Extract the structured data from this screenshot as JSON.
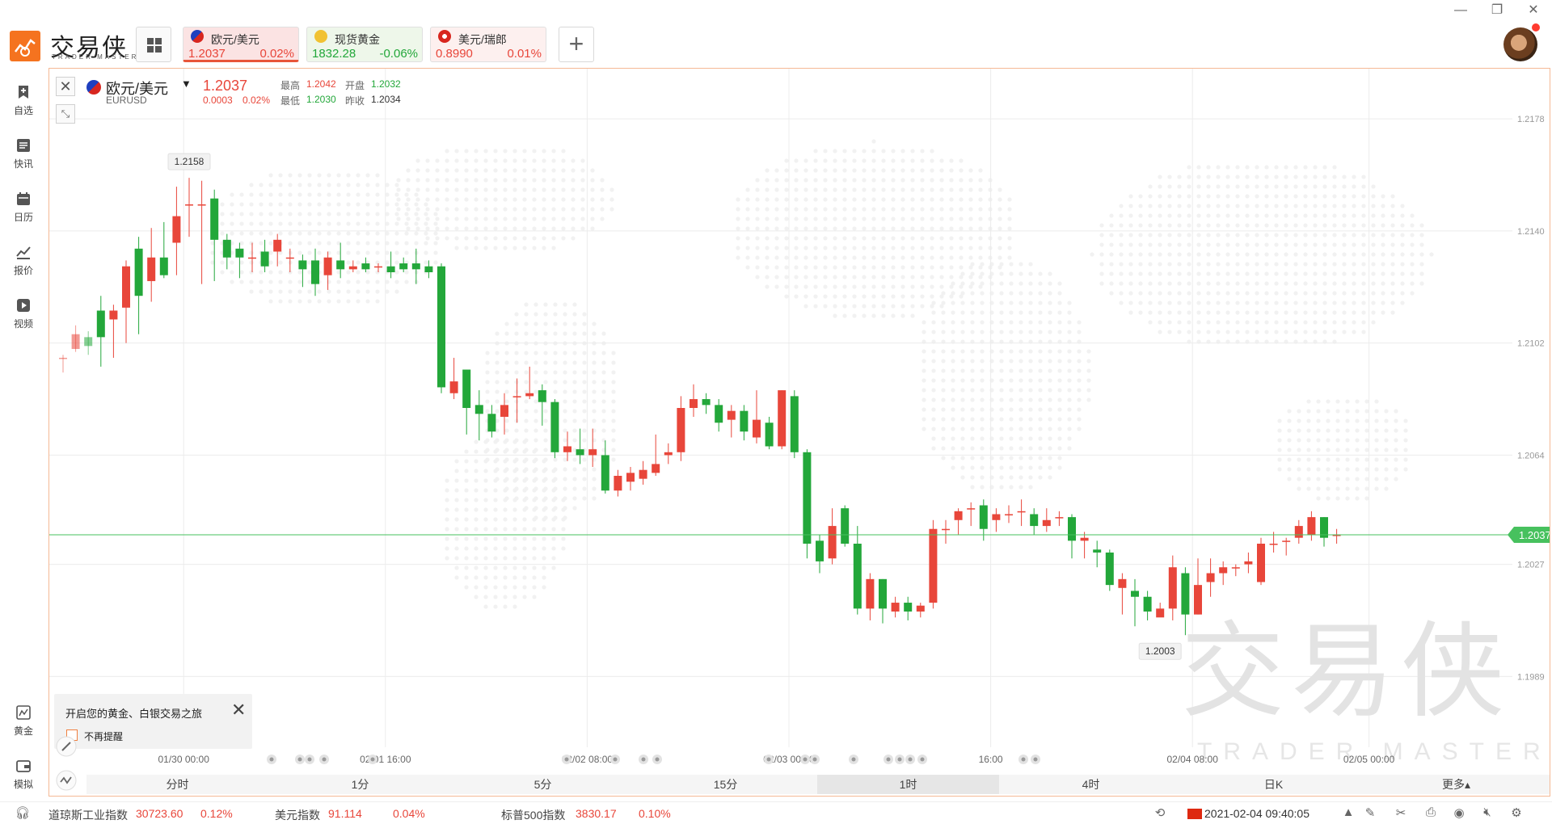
{
  "app": {
    "logo_text": "交易侠",
    "logo_sub": "TRADER MASTER"
  },
  "window_controls": {
    "minimize": "—",
    "restore": "❐",
    "close": "✕"
  },
  "quote_cards": [
    {
      "name": "欧元/美元",
      "price": "1.2037",
      "change": "0.02%",
      "direction": "up",
      "active": true,
      "flag": "us-eu"
    },
    {
      "name": "现货黄金",
      "price": "1832.28",
      "change": "-0.06%",
      "direction": "down",
      "active": false,
      "flag": "gold"
    },
    {
      "name": "美元/瑞郎",
      "price": "0.8990",
      "change": "0.01%",
      "direction": "up",
      "active": false,
      "flag": "ch"
    }
  ],
  "add_button": "+",
  "sidebar": {
    "items": [
      {
        "label": "自选",
        "icon": "bookmark-add-icon"
      },
      {
        "label": "快讯",
        "icon": "news-icon"
      },
      {
        "label": "日历",
        "icon": "calendar-icon"
      },
      {
        "label": "报价",
        "icon": "quote-chart-icon"
      },
      {
        "label": "视频",
        "icon": "video-icon"
      }
    ],
    "bottom_items": [
      {
        "label": "黄金",
        "icon": "gold-icon"
      },
      {
        "label": "模拟",
        "icon": "wallet-icon"
      }
    ]
  },
  "symbol": {
    "name": "欧元/美元",
    "code": "EURUSD",
    "price": "1.2037",
    "change": "0.0003",
    "change_pct": "0.02%",
    "stats": {
      "high_label": "最高",
      "high": "1.2042",
      "open_label": "开盘",
      "open": "1.2032",
      "low_label": "最低",
      "low": "1.2030",
      "prev_close_label": "昨收",
      "prev_close": "1.2034"
    }
  },
  "notice": {
    "text": "开启您的黄金、白银交易之旅",
    "checkbox_label": "不再提醒"
  },
  "watermark": {
    "title": "交易侠",
    "sub": "TRADER MASTER"
  },
  "timeframes": [
    {
      "label": "分时",
      "active": false
    },
    {
      "label": "1分",
      "active": false
    },
    {
      "label": "5分",
      "active": false
    },
    {
      "label": "15分",
      "active": false
    },
    {
      "label": "1时",
      "active": true
    },
    {
      "label": "4时",
      "active": false
    },
    {
      "label": "日K",
      "active": false
    },
    {
      "label": "更多▴",
      "active": false
    }
  ],
  "status_bar": {
    "indices": [
      {
        "name": "道琼斯工业指数",
        "value": "30723.60",
        "change": "0.12%"
      },
      {
        "name": "美元指数",
        "value": "91.114",
        "change": "0.04%"
      },
      {
        "name": "标普500指数",
        "value": "3830.17",
        "change": "0.10%"
      }
    ],
    "datetime": "2021-02-04 09:40:05"
  },
  "colors": {
    "up": "#e8463a",
    "down": "#23a73a",
    "accent": "#f5731f",
    "current_price_line": "#47c15e"
  },
  "chart_data": {
    "type": "candlestick",
    "symbol": "EURUSD",
    "timeframe": "1时",
    "ylim": [
      1.1965,
      1.2195
    ],
    "y_ticks": [
      "1.2178",
      "1.2140",
      "1.2102",
      "1.2064",
      "1.2027",
      "1.1989"
    ],
    "x_ticks": [
      "01/30 00:00",
      "02/01 16:00",
      "02/02 08:00",
      "02/03 00:00",
      "16:00",
      "02/04 08:00",
      "02/05 00:00"
    ],
    "current_price": "1.2037",
    "max_marker": "1.2158",
    "min_marker": "1.2003",
    "candles": [
      [
        1.2097,
        1.2097,
        1.2092,
        1.2098
      ],
      [
        1.21,
        1.2105,
        1.2099,
        1.2108
      ],
      [
        1.2104,
        1.2101,
        1.2098,
        1.2106
      ],
      [
        1.2113,
        1.2104,
        1.2094,
        1.2118
      ],
      [
        1.211,
        1.2113,
        1.2097,
        1.2115
      ],
      [
        1.2114,
        1.2128,
        1.2102,
        1.213
      ],
      [
        1.2134,
        1.2118,
        1.2105,
        1.2138
      ],
      [
        1.2123,
        1.2131,
        1.2116,
        1.2141
      ],
      [
        1.2131,
        1.2125,
        1.2124,
        1.2143
      ],
      [
        1.2136,
        1.2145,
        1.2125,
        1.2155
      ],
      [
        1.2149,
        1.2149,
        1.2138,
        1.2158
      ],
      [
        1.2149,
        1.2149,
        1.2122,
        1.2157
      ],
      [
        1.2151,
        1.2137,
        1.2123,
        1.2154
      ],
      [
        1.2137,
        1.2131,
        1.2127,
        1.2139
      ],
      [
        1.2134,
        1.2131,
        1.2124,
        1.2136
      ],
      [
        1.2131,
        1.2131,
        1.2126,
        1.2136
      ],
      [
        1.2133,
        1.2128,
        1.2126,
        1.2137
      ],
      [
        1.2133,
        1.2137,
        1.2128,
        1.2139
      ],
      [
        1.2131,
        1.2131,
        1.2126,
        1.2134
      ],
      [
        1.213,
        1.2127,
        1.2121,
        1.2132
      ],
      [
        1.213,
        1.2122,
        1.2118,
        1.2134
      ],
      [
        1.2125,
        1.2131,
        1.212,
        1.2133
      ],
      [
        1.213,
        1.2127,
        1.2124,
        1.2136
      ],
      [
        1.2127,
        1.2128,
        1.2126,
        1.213
      ],
      [
        1.2129,
        1.2127,
        1.2126,
        1.2131
      ],
      [
        1.2128,
        1.2128,
        1.2126,
        1.2129
      ],
      [
        1.2128,
        1.2126,
        1.2124,
        1.2133
      ],
      [
        1.2129,
        1.2127,
        1.2126,
        1.2131
      ],
      [
        1.2129,
        1.2127,
        1.2122,
        1.2134
      ],
      [
        1.2128,
        1.2126,
        1.2124,
        1.213
      ],
      [
        1.2128,
        1.2087,
        1.2085,
        1.2129
      ],
      [
        1.2085,
        1.2089,
        1.2083,
        1.2097
      ],
      [
        1.2093,
        1.208,
        1.2071,
        1.2093
      ],
      [
        1.2081,
        1.2078,
        1.2069,
        1.2086
      ],
      [
        1.2078,
        1.2072,
        1.207,
        1.2081
      ],
      [
        1.2077,
        1.2081,
        1.2071,
        1.2085
      ],
      [
        1.2084,
        1.2084,
        1.2075,
        1.209
      ],
      [
        1.2084,
        1.2085,
        1.2083,
        1.2094
      ],
      [
        1.2086,
        1.2082,
        1.2074,
        1.2088
      ],
      [
        1.2082,
        1.2065,
        1.2063,
        1.2083
      ],
      [
        1.2065,
        1.2067,
        1.2062,
        1.2072
      ],
      [
        1.2066,
        1.2064,
        1.2061,
        1.2073
      ],
      [
        1.2064,
        1.2066,
        1.206,
        1.2073
      ],
      [
        1.2064,
        1.2052,
        1.2051,
        1.2069
      ],
      [
        1.2052,
        1.2057,
        1.205,
        1.2059
      ],
      [
        1.2055,
        1.2058,
        1.2052,
        1.206
      ],
      [
        1.2056,
        1.2059,
        1.2054,
        1.2062
      ],
      [
        1.2058,
        1.2061,
        1.2057,
        1.2071
      ],
      [
        1.2064,
        1.2065,
        1.2061,
        1.2068
      ],
      [
        1.2065,
        1.208,
        1.2062,
        1.2084
      ],
      [
        1.208,
        1.2083,
        1.2077,
        1.2088
      ],
      [
        1.2083,
        1.2081,
        1.2078,
        1.2085
      ],
      [
        1.2081,
        1.2075,
        1.2072,
        1.2083
      ],
      [
        1.2076,
        1.2079,
        1.207,
        1.2081
      ],
      [
        1.2079,
        1.2072,
        1.2069,
        1.2081
      ],
      [
        1.207,
        1.2076,
        1.2068,
        1.2086
      ],
      [
        1.2075,
        1.2067,
        1.2066,
        1.2077
      ],
      [
        1.2067,
        1.2086,
        1.2066,
        1.2086
      ],
      [
        1.2084,
        1.2065,
        1.2063,
        1.2086
      ],
      [
        1.2065,
        1.2034,
        1.2029,
        1.2066
      ],
      [
        1.2035,
        1.2028,
        1.2024,
        1.2037
      ],
      [
        1.2029,
        1.204,
        1.2027,
        1.2046
      ],
      [
        1.2046,
        1.2034,
        1.2033,
        1.2047
      ],
      [
        1.2034,
        1.2012,
        1.201,
        1.204
      ],
      [
        1.2012,
        1.2022,
        1.2008,
        1.2024
      ],
      [
        1.2022,
        1.2012,
        1.2007,
        1.2022
      ],
      [
        1.2011,
        1.2014,
        1.2009,
        1.2016
      ],
      [
        1.2014,
        1.2011,
        1.2008,
        1.2016
      ],
      [
        1.2011,
        1.2013,
        1.2009,
        1.2014
      ],
      [
        1.2014,
        1.2039,
        1.2012,
        1.2042
      ],
      [
        1.2039,
        1.2039,
        1.2034,
        1.2042
      ],
      [
        1.2042,
        1.2045,
        1.2037,
        1.2046
      ],
      [
        1.2046,
        1.2046,
        1.204,
        1.2048
      ],
      [
        1.2047,
        1.2039,
        1.2035,
        1.2049
      ],
      [
        1.2042,
        1.2044,
        1.2038,
        1.2046
      ],
      [
        1.2044,
        1.2044,
        1.2041,
        1.2047
      ],
      [
        1.2045,
        1.2045,
        1.204,
        1.2049
      ],
      [
        1.2044,
        1.204,
        1.2037,
        1.2046
      ],
      [
        1.204,
        1.2042,
        1.2038,
        1.2046
      ],
      [
        1.2043,
        1.2043,
        1.204,
        1.2045
      ],
      [
        1.2043,
        1.2035,
        1.2029,
        1.2044
      ],
      [
        1.2035,
        1.2036,
        1.2029,
        1.2038
      ],
      [
        1.2032,
        1.2031,
        1.2026,
        1.2035
      ],
      [
        1.2031,
        1.202,
        1.2018,
        1.2032
      ],
      [
        1.2019,
        1.2022,
        1.201,
        1.2024
      ],
      [
        1.2018,
        1.2016,
        1.2006,
        1.2022
      ],
      [
        1.2016,
        1.2011,
        1.2008,
        1.2018
      ],
      [
        1.2009,
        1.2012,
        1.201,
        1.2014
      ],
      [
        1.2012,
        1.2026,
        1.2008,
        1.203
      ],
      [
        1.2024,
        1.201,
        1.2003,
        1.2026
      ],
      [
        1.201,
        1.202,
        1.201,
        1.2029
      ],
      [
        1.2021,
        1.2024,
        1.2016,
        1.2029
      ],
      [
        1.2024,
        1.2026,
        1.202,
        1.2028
      ],
      [
        1.2026,
        1.2026,
        1.2023,
        1.2027
      ],
      [
        1.2027,
        1.2028,
        1.2024,
        1.2031
      ],
      [
        1.2021,
        1.2034,
        1.202,
        1.2036
      ],
      [
        1.2034,
        1.2034,
        1.2031,
        1.2038
      ],
      [
        1.2035,
        1.2035,
        1.203,
        1.2036
      ],
      [
        1.2036,
        1.204,
        1.2034,
        1.2042
      ],
      [
        1.2037,
        1.2043,
        1.2035,
        1.2045
      ],
      [
        1.2043,
        1.2036,
        1.2033,
        1.2043
      ],
      [
        1.2037,
        1.2037,
        1.2034,
        1.2039
      ]
    ]
  }
}
